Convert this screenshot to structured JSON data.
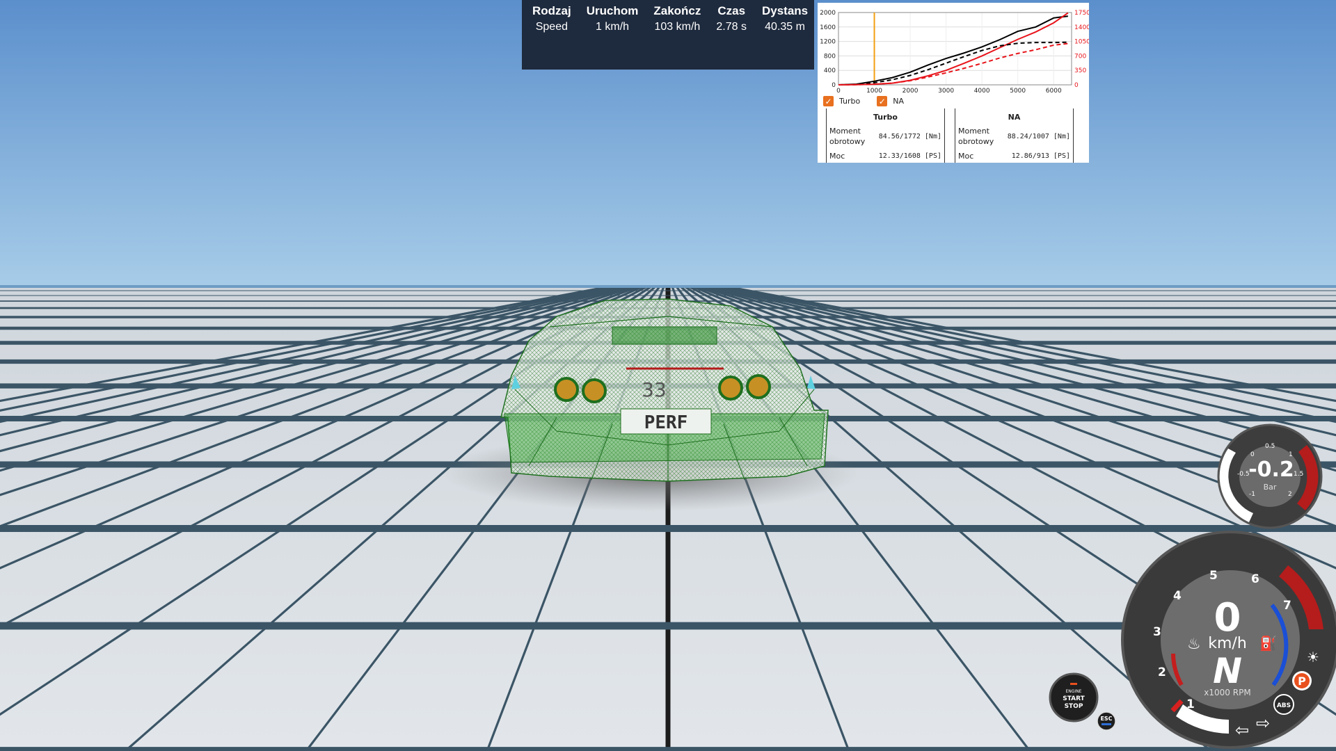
{
  "timing": {
    "headers": [
      "Rodzaj",
      "Uruchom",
      "Zakończ",
      "Czas",
      "Dystans"
    ],
    "row": [
      "Speed",
      "1 km/h",
      "103 km/h",
      "2.78 s",
      "40.35 m"
    ]
  },
  "chart_data": {
    "type": "line",
    "x_ticks": [
      "0",
      "1000",
      "2000",
      "3000",
      "4000",
      "5000",
      "6000"
    ],
    "y_left_ticks": [
      "0",
      "400",
      "800",
      "1200",
      "1600",
      "2000"
    ],
    "y_right_ticks": [
      "0",
      "350",
      "700",
      "1050",
      "1400",
      "1750"
    ],
    "xlim": [
      0,
      6500
    ],
    "ylim_left": [
      0,
      2000
    ],
    "ylim_right": [
      0,
      1750
    ],
    "marker_x": 1000,
    "legend": [
      "Turbo",
      "NA"
    ],
    "series": [
      {
        "name": "Turbo",
        "kind": "torque",
        "color": "#000000",
        "dash": false,
        "axis": "left",
        "x": [
          0,
          500,
          1000,
          1500,
          2000,
          2500,
          3000,
          3500,
          4000,
          4500,
          5000,
          5500,
          6000,
          6400
        ],
        "y": [
          0,
          20,
          100,
          200,
          350,
          550,
          730,
          880,
          1050,
          1250,
          1480,
          1600,
          1850,
          1900
        ]
      },
      {
        "name": "NA",
        "kind": "torque",
        "color": "#e8141b",
        "dash": false,
        "axis": "right",
        "x": [
          0,
          500,
          1000,
          1500,
          2000,
          2500,
          3000,
          3500,
          4000,
          4500,
          5000,
          5500,
          6000,
          6400
        ],
        "y": [
          0,
          5,
          15,
          40,
          110,
          220,
          350,
          520,
          700,
          900,
          1100,
          1280,
          1500,
          1740
        ]
      },
      {
        "name": "Turbo",
        "kind": "power",
        "color": "#000000",
        "dash": true,
        "axis": "left",
        "x": [
          0,
          500,
          1000,
          1500,
          2000,
          2500,
          3000,
          3500,
          4000,
          4500,
          5000,
          5500,
          6000,
          6400
        ],
        "y": [
          0,
          10,
          60,
          140,
          260,
          420,
          600,
          780,
          950,
          1080,
          1150,
          1170,
          1170,
          1180
        ]
      },
      {
        "name": "NA",
        "kind": "power",
        "color": "#e8141b",
        "dash": true,
        "axis": "right",
        "x": [
          0,
          500,
          1000,
          1500,
          2000,
          2500,
          3000,
          3500,
          4000,
          4500,
          5000,
          5500,
          6000,
          6400
        ],
        "y": [
          0,
          5,
          15,
          40,
          100,
          190,
          290,
          400,
          520,
          650,
          760,
          850,
          960,
          1000
        ]
      }
    ]
  },
  "stats": {
    "turbo": {
      "title": "Turbo",
      "torque_label": "Moment obrotowy",
      "torque_value": "84.56/1772 [Nm]",
      "power_label": "Moc",
      "power_value": "12.33/1608 [PS]"
    },
    "na": {
      "title": "NA",
      "torque_label": "Moment obrotowy",
      "torque_value": "88.24/1007 [Nm]",
      "power_label": "Moc",
      "power_value": "12.86/913 [PS]"
    }
  },
  "car": {
    "plate": "PERF",
    "badge": "33"
  },
  "boost_gauge": {
    "value": "-0.2",
    "unit": "Bar",
    "ticks": [
      "0",
      "0.5",
      "1",
      "1.5",
      "2",
      "-0.5",
      "-1"
    ]
  },
  "speedometer": {
    "speed": "0",
    "unit": "km/h",
    "gear": "N",
    "rpm_label": "x1000 RPM",
    "rpm_ticks": [
      "1",
      "2",
      "3",
      "4",
      "5",
      "6",
      "7"
    ]
  },
  "engine_button": {
    "line1": "ENGINE",
    "line2": "START",
    "line3": "STOP"
  },
  "esc_label": "ESC",
  "indicators": {
    "parking": "P",
    "abs": "ABS"
  },
  "colors": {
    "accent": "#e8701e",
    "panel": "#1e2a3d",
    "redline": "#b51c1c",
    "blue_arc": "#1a4fd6",
    "wire_green": "#1e8f1e"
  }
}
